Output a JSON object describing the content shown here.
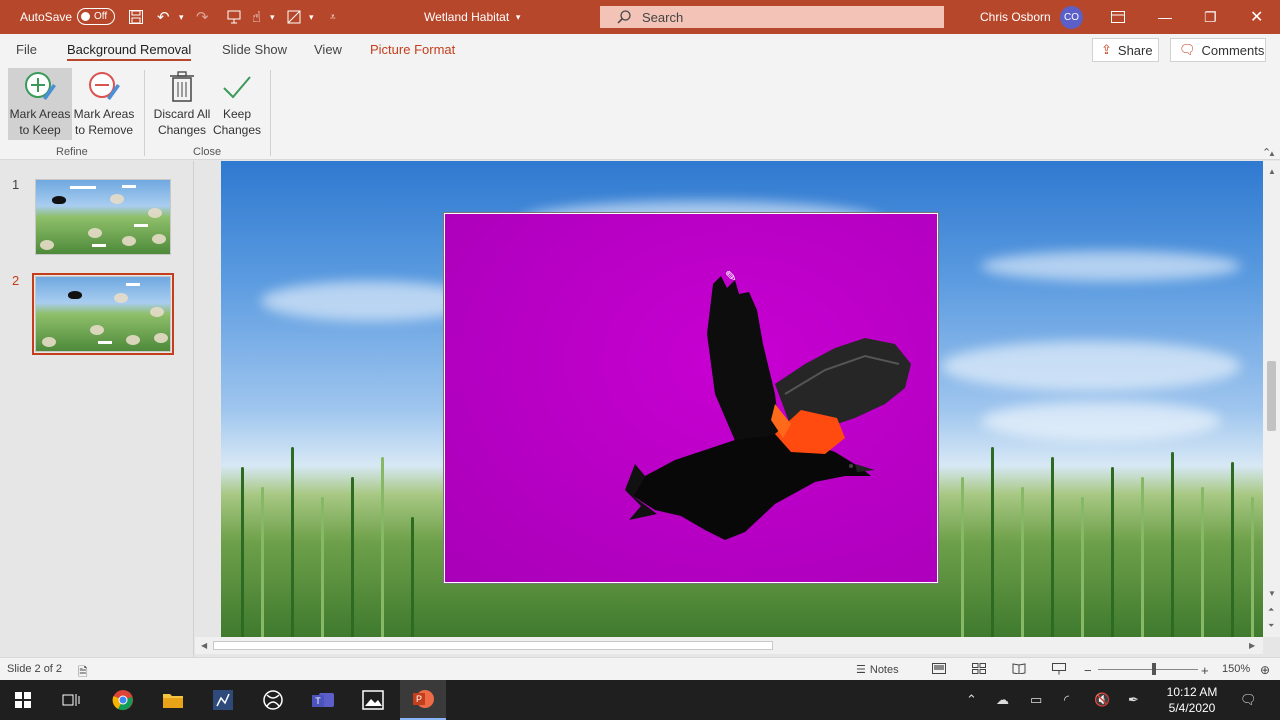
{
  "titlebar": {
    "autosave_label": "AutoSave",
    "autosave_state": "Off",
    "document_title": "Wetland Habitat",
    "search_placeholder": "Search",
    "user_name": "Chris Osborn",
    "user_initials": "CO"
  },
  "tabs": [
    {
      "label": "File"
    },
    {
      "label": "Background Removal"
    },
    {
      "label": "Slide Show"
    },
    {
      "label": "View"
    },
    {
      "label": "Picture Format"
    }
  ],
  "share_label": "Share",
  "comments_label": "Comments",
  "ribbon": {
    "mark_keep": {
      "line1": "Mark Areas",
      "line2": "to Keep"
    },
    "mark_remove": {
      "line1": "Mark Areas",
      "line2": "to Remove"
    },
    "discard": {
      "line1": "Discard All",
      "line2": "Changes"
    },
    "keep": {
      "line1": "Keep",
      "line2": "Changes"
    },
    "group_refine": "Refine",
    "group_close": "Close"
  },
  "slides": [
    {
      "number": "1"
    },
    {
      "number": "2"
    }
  ],
  "status": {
    "slide_count": "Slide 2 of 2",
    "notes_label": "Notes",
    "zoom": "150%"
  },
  "clock": {
    "time": "10:12 AM",
    "date": "5/4/2020"
  },
  "colors": {
    "accent": "#b7472a",
    "removal_magenta": "#c000c8"
  }
}
